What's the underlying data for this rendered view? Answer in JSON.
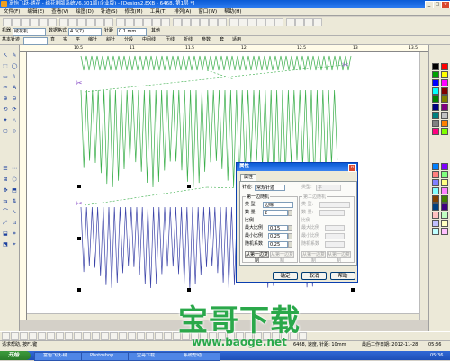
{
  "window": {
    "title": "富怡飞跃-绣花 - 绣花制版系统V6.301版(企业版) - [Design2.EXB - 6468, 第1层 *]",
    "controls": [
      "_",
      "□",
      "×"
    ]
  },
  "menu": [
    "文件(F)",
    "编辑(E)",
    "查看(V)",
    "绘图(D)",
    "针迹(S)",
    "修改(M)",
    "工具(T)",
    "排列(A)",
    "窗口(W)",
    "帮助(H)"
  ],
  "toolbar2": {
    "machine_label": "机器",
    "machine_value": "绣花机",
    "data_format_label": "数据格式",
    "data_format_value": "4.3(7)",
    "fill_label": "针距",
    "fill_value": "0.1 mm",
    "others": "其他"
  },
  "toolbar3": {
    "stitch_label": "基本针迹",
    "stitch_value": "",
    "items": [
      "直",
      "实",
      "平",
      "缩针",
      "斜针",
      "分段",
      "中间线",
      "压线",
      "折线",
      "参数",
      "套",
      "适用"
    ]
  },
  "ruler": {
    "marks": [
      "10.5",
      "11",
      "11.5",
      "12",
      "12.5",
      "13",
      "13.5"
    ]
  },
  "dialog": {
    "title": "属性",
    "close": "×",
    "tab": "属性",
    "page_label": "针迹:",
    "page_value": "常规针迹",
    "right_top_label": "类型:",
    "right_top_value": "平",
    "group1_title": "第一边随机",
    "group1_type_label": "类 型:",
    "group1_type_value": "边缘",
    "group1_count_label": "数 量:",
    "group1_count_value": "2",
    "group1_ratio_label": "比例",
    "group1_max_label": "最大比例",
    "group1_max_value": "0.15",
    "group1_min_label": "最小比例",
    "group1_min_value": "0.25",
    "group1_rand_label": "随机系数",
    "group1_rand_value": "0.25",
    "group1_btn_left": "从第一边复制",
    "group1_btn_right": "从第一边复制",
    "group2_title": "第二边随机",
    "group2_type_label": "类 型:",
    "group2_type_value": "",
    "group2_count_label": "数 量:",
    "group2_count_value": "",
    "group2_ratio_label": "比例",
    "group2_max_label": "最大比例",
    "group2_min_label": "最小比例",
    "group2_rand_label": "随机系数",
    "group2_btn_left": "从第一边复制",
    "group2_btn_right": "从第一边复制",
    "ok": "确定",
    "cancel": "取消",
    "help": "帮助"
  },
  "status": {
    "left": "请求帮助, 按F1键",
    "middle": "6468, 速度, 针距: 10mm",
    "right": "最后工作日期: 2012-11-28",
    "time_label": "05:36"
  },
  "taskbar": {
    "start": "开始",
    "tasks": [
      "富怡飞跃-绣...",
      "Photoshop...",
      "宝哥下载",
      "系统帮助"
    ],
    "clock": "05:36"
  },
  "watermark": {
    "text": "宝哥下载",
    "url": "www.baoge.net"
  },
  "colors": {
    "accent": "#0a5bd6",
    "green_stitch": "#3aae4a",
    "blue_stitch": "#3b43a8",
    "watermark": "#2aa84a"
  },
  "palette_colors": [
    "#000000",
    "#ff0000",
    "#00a000",
    "#ffff00",
    "#0000ff",
    "#ff00ff",
    "#00ffff",
    "#800000",
    "#008000",
    "#808000",
    "#000080",
    "#800080",
    "#008080",
    "#c0c0c0",
    "#808080",
    "#ff8000",
    "#ff0080",
    "#80ff00",
    "#0080ff",
    "#8000ff",
    "#ff8080",
    "#80ff80",
    "#8080ff",
    "#ffff80",
    "#80ffff",
    "#ff80ff",
    "#804000",
    "#408000",
    "#004080",
    "#400080",
    "#ffc0c0",
    "#c0ffc0",
    "#c0c0ff",
    "#ffffc0",
    "#c0ffff",
    "#ffc0ff"
  ]
}
